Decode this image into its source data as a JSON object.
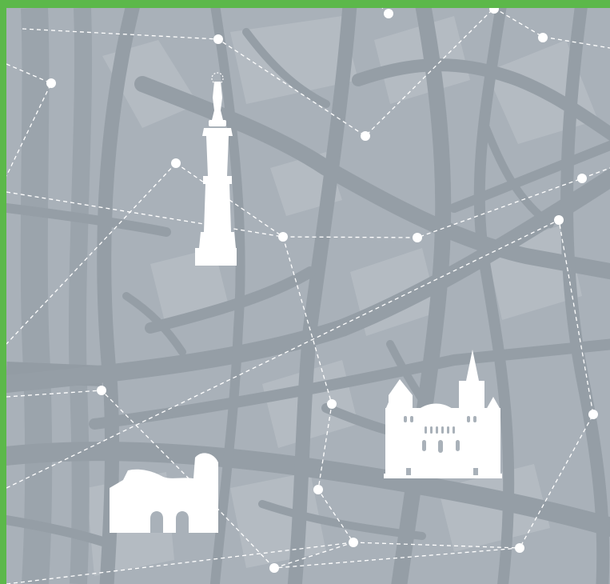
{
  "map": {
    "title": "",
    "colors": {
      "frame": "#5cb84a",
      "land": "#a9b1b9",
      "block_light": "#b6bdc4",
      "road": "#959ea6",
      "road_major": "#8e979f",
      "river": "#9aa3ab",
      "route_line": "#ffffff",
      "landmark": "#ffffff"
    },
    "landmarks": [
      {
        "id": "victory-column",
        "icon": "column-monument-icon",
        "label": ""
      },
      {
        "id": "cathedral",
        "icon": "cathedral-icon",
        "label": ""
      },
      {
        "id": "city-gate",
        "icon": "ruined-gate-icon",
        "label": ""
      }
    ],
    "route_points_count": 17,
    "route_style": "dashed"
  }
}
